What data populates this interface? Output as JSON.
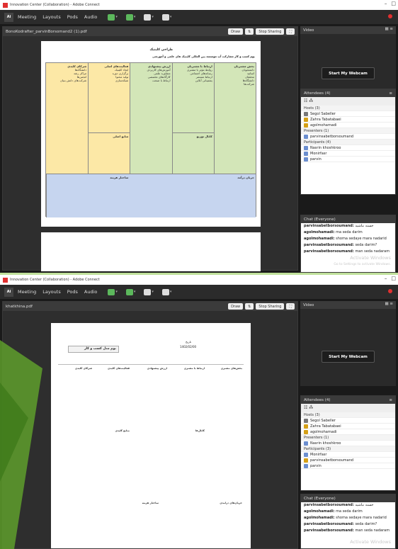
{
  "top": {
    "window_title": "Innovation Center (Collaboration) - Adobe Connect",
    "menu": [
      "Meeting",
      "Layouts",
      "Pods",
      "Audio"
    ],
    "doc_filename": "BonoKodrafter_parvinBorsomand2 (1).pdf",
    "doc_buttons": {
      "draw": "Draw",
      "stop_sharing": "Stop Sharing"
    },
    "video_title": "Video",
    "webcam_button": "Start My Webcam",
    "attendees_title": "Attendees",
    "attendees_count": "(4)",
    "hosts_label": "Hosts (3)",
    "hosts": [
      "Segol Sabeller",
      "Zahra Tabatabaei",
      "agolmohamadi"
    ],
    "presenters_label": "Presenters (1)",
    "presenters": [
      "parvinsabetborsoumand"
    ],
    "participants_label": "Participants (4)",
    "participants": [
      "Nasrin khoshkroo",
      "Monirfasr",
      "parvin"
    ],
    "chat_title": "Chat",
    "chat_scope": "(Everyone)",
    "chat": [
      {
        "name": "parvinsabetborsoumand:",
        "text": "خسته نباشید"
      },
      {
        "name": "agolmohamadi:",
        "text": "ma seda darim"
      },
      {
        "name": "agolmohamadi:",
        "text": "shoma sedaye mara nadarid"
      },
      {
        "name": "parvinsabetborsoumand:",
        "text": "seda darim?"
      },
      {
        "name": "parvinsabetborsoumand:",
        "text": "man seda nadaram"
      }
    ],
    "activate": "Activate Windows",
    "activate_sub": "Go to Settings to activate Windows.",
    "page_title": "طراحی کلینیک",
    "page_subtitle": "بوم کسب و کار مشارکت آپ موسسه بین المللی کلینیک های علمی و آموزشی",
    "columns": [
      {
        "title": "بخش مشتریان",
        "lines": [
          "دانشجویان",
          "اساتید",
          "محققان",
          "دانشگاه‌ها",
          "شرکت‌ها"
        ]
      },
      {
        "title": "ارتباط با مشتریان",
        "lines": [
          "روابط مؤثر با مشتری",
          "رسانه‌های اجتماعی",
          "ارتباط مستمر",
          "پشتیبانی آنلاین"
        ]
      },
      {
        "title": "ارزش پیشنهادی",
        "lines": [
          "آموزش‌های کاربردی",
          "مشاوره علمی",
          "کارگاه‌های تخصصی",
          "ارتباط با صنعت"
        ]
      },
      {
        "title": "فعالیت‌های اصلی",
        "lines": [
          "ایجاد کلینیک",
          "برگزاری دوره",
          "تولید محتوا",
          "شبکه‌سازی"
        ]
      },
      {
        "title": "شرکای کلیدی",
        "lines": [
          "دانشگاه‌ها",
          "مراکز رشد",
          "انجمن‌ها",
          "شرکت‌های دانش بنیان"
        ]
      }
    ],
    "channels_title": "کانال توزیع",
    "resources_title": "منابع اصلی",
    "cost_title": "ساختار هزینه",
    "revenue_title": "جریان درآمد"
  },
  "bottom": {
    "window_title": "Innovation Center (Collaboration) - Adobe Connect",
    "menu": [
      "Meeting",
      "Layouts",
      "Pods",
      "Audio"
    ],
    "doc_filename": "khatkhina.pdf",
    "doc_buttons": {
      "draw": "Draw",
      "stop_sharing": "Stop Sharing"
    },
    "video_title": "Video",
    "webcam_button": "Start My Webcam",
    "attendees_title": "Attendees",
    "attendees_count": "(4)",
    "hosts_label": "Hosts (3)",
    "hosts": [
      "Segol Sabeller",
      "Zahra Tabatabaei",
      "agolmohamadi"
    ],
    "presenters_label": "Presenters (1)",
    "presenters": [
      "Nasrin khoshkroo"
    ],
    "participants_label": "Participants (3)",
    "participants": [
      "Monirfasr",
      "parvinsabetborsoumand",
      "parvin"
    ],
    "chat_title": "Chat",
    "chat_scope": "(Everyone)",
    "chat": [
      {
        "name": "parvinsabetborsoumand:",
        "text": "خسته نباشید"
      },
      {
        "name": "agolmohamadi:",
        "text": "ma seda darim"
      },
      {
        "name": "agolmohamadi:",
        "text": "shoma sedaye mara nadarid"
      },
      {
        "name": "parvinsabetborsoumand:",
        "text": "seda darim?"
      },
      {
        "name": "parvinsabetborsoumand:",
        "text": "man seda nadaram"
      }
    ],
    "activate": "Activate Windows",
    "form_title": "بوم مدل کسب و کار",
    "date_label": "تاریخ",
    "date_value": "1402/02/00",
    "col_titles": [
      "بخش‌های مشتری",
      "ارتباط با مشتری",
      "ارزش پیشنهادی",
      "فعالیت‌های کلیدی",
      "شرکای کلیدی"
    ],
    "channels_title": "کانال‌ها",
    "resources_title": "منابع کلیدی",
    "cost_title": "ساختار هزینه",
    "revenue_title": "جریان‌های درآمدی"
  },
  "colors": {
    "yellow": "#fce8a6",
    "green": "#d3e6b8",
    "blue": "#c6d5ef",
    "desktop": "#bfe09a",
    "accent_red": "#e03030"
  }
}
